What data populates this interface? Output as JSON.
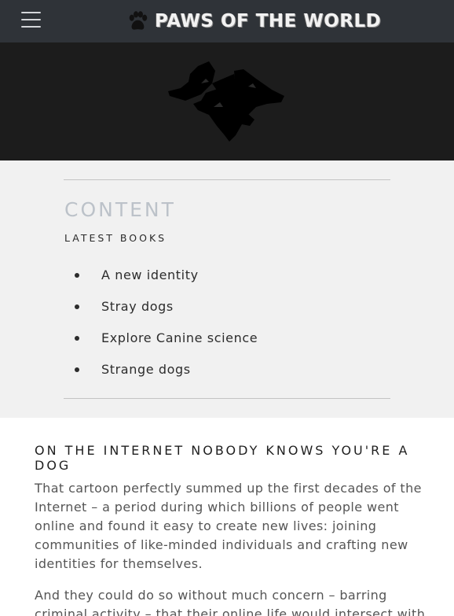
{
  "header": {
    "brand": "PAWS OF THE WORLD",
    "brand_icon": "paw-icon",
    "menu_icon": "hamburger-menu-icon"
  },
  "hero": {
    "logo": "three-headed-dog-logo"
  },
  "content": {
    "heading": "CONTENT",
    "subheading": "LATEST BOOKS",
    "books": [
      "A new identity",
      "Stray dogs",
      "Explore Canine science",
      "Strange dogs"
    ]
  },
  "article": {
    "title": "ON THE INTERNET NOBODY KNOWS YOU'RE A DOG",
    "paragraphs": [
      "That cartoon perfectly summed up the first decades of the Internet – a period during which billions of people went online and found it easy to create new lives: joining communities of like-minded individuals and crafting new identities for themselves.",
      "And they could do so without much concern – barring criminal activity – that their online life would intersect with"
    ]
  },
  "colors": {
    "navbar_bg": "#2f3338",
    "hero_bg": "#1c1c1c",
    "content_bg": "#f1f1f1",
    "heading_muted": "#bcc2c9"
  }
}
